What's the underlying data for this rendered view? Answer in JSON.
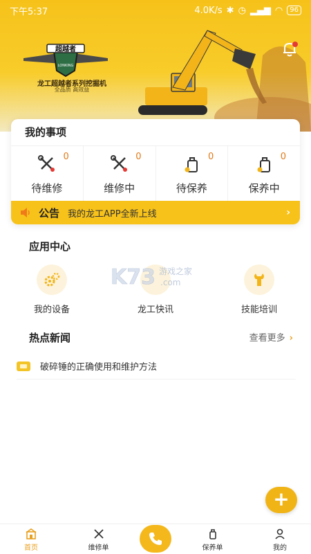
{
  "status_bar": {
    "time": "下午5:37",
    "network_speed": "4.0K/s",
    "battery": "96"
  },
  "banner": {
    "brand_logo": "超越者",
    "logo_caption": "LONKING",
    "series_title": "龙工超越者系列挖掘机",
    "slogan": "全品质 高效益"
  },
  "my_items": {
    "title": "我的事项",
    "items": [
      {
        "label": "待维修",
        "count": "0",
        "icon": "wrench-screwdriver-icon"
      },
      {
        "label": "维修中",
        "count": "0",
        "icon": "wrench-screwdriver-icon"
      },
      {
        "label": "待保养",
        "count": "0",
        "icon": "oil-can-icon"
      },
      {
        "label": "保养中",
        "count": "0",
        "icon": "oil-can-icon"
      }
    ]
  },
  "notice": {
    "title": "公告",
    "text": "我的龙工APP全新上线"
  },
  "app_center": {
    "title": "应用中心",
    "apps": [
      {
        "label": "我的设备",
        "icon": "gears-icon"
      },
      {
        "label": "龙工快讯",
        "icon": "news-icon"
      },
      {
        "label": "技能培训",
        "icon": "wrench-icon"
      }
    ]
  },
  "watermark": {
    "main": "K73",
    "sub": "游戏之家",
    "domain": ".com"
  },
  "hot_news": {
    "title": "热点新闻",
    "more": "查看更多",
    "items": [
      {
        "title": "破碎锤的正确使用和维护方法"
      }
    ]
  },
  "fab": {
    "label": "+"
  },
  "bottom_nav": {
    "items": [
      {
        "label": "首页",
        "active": true
      },
      {
        "label": "维修单"
      },
      {
        "label": "保养单"
      },
      {
        "label": "我的"
      }
    ]
  },
  "colors": {
    "accent": "#f4b81c",
    "count": "#e07a1a",
    "notice_bg": "#f7c21a"
  }
}
